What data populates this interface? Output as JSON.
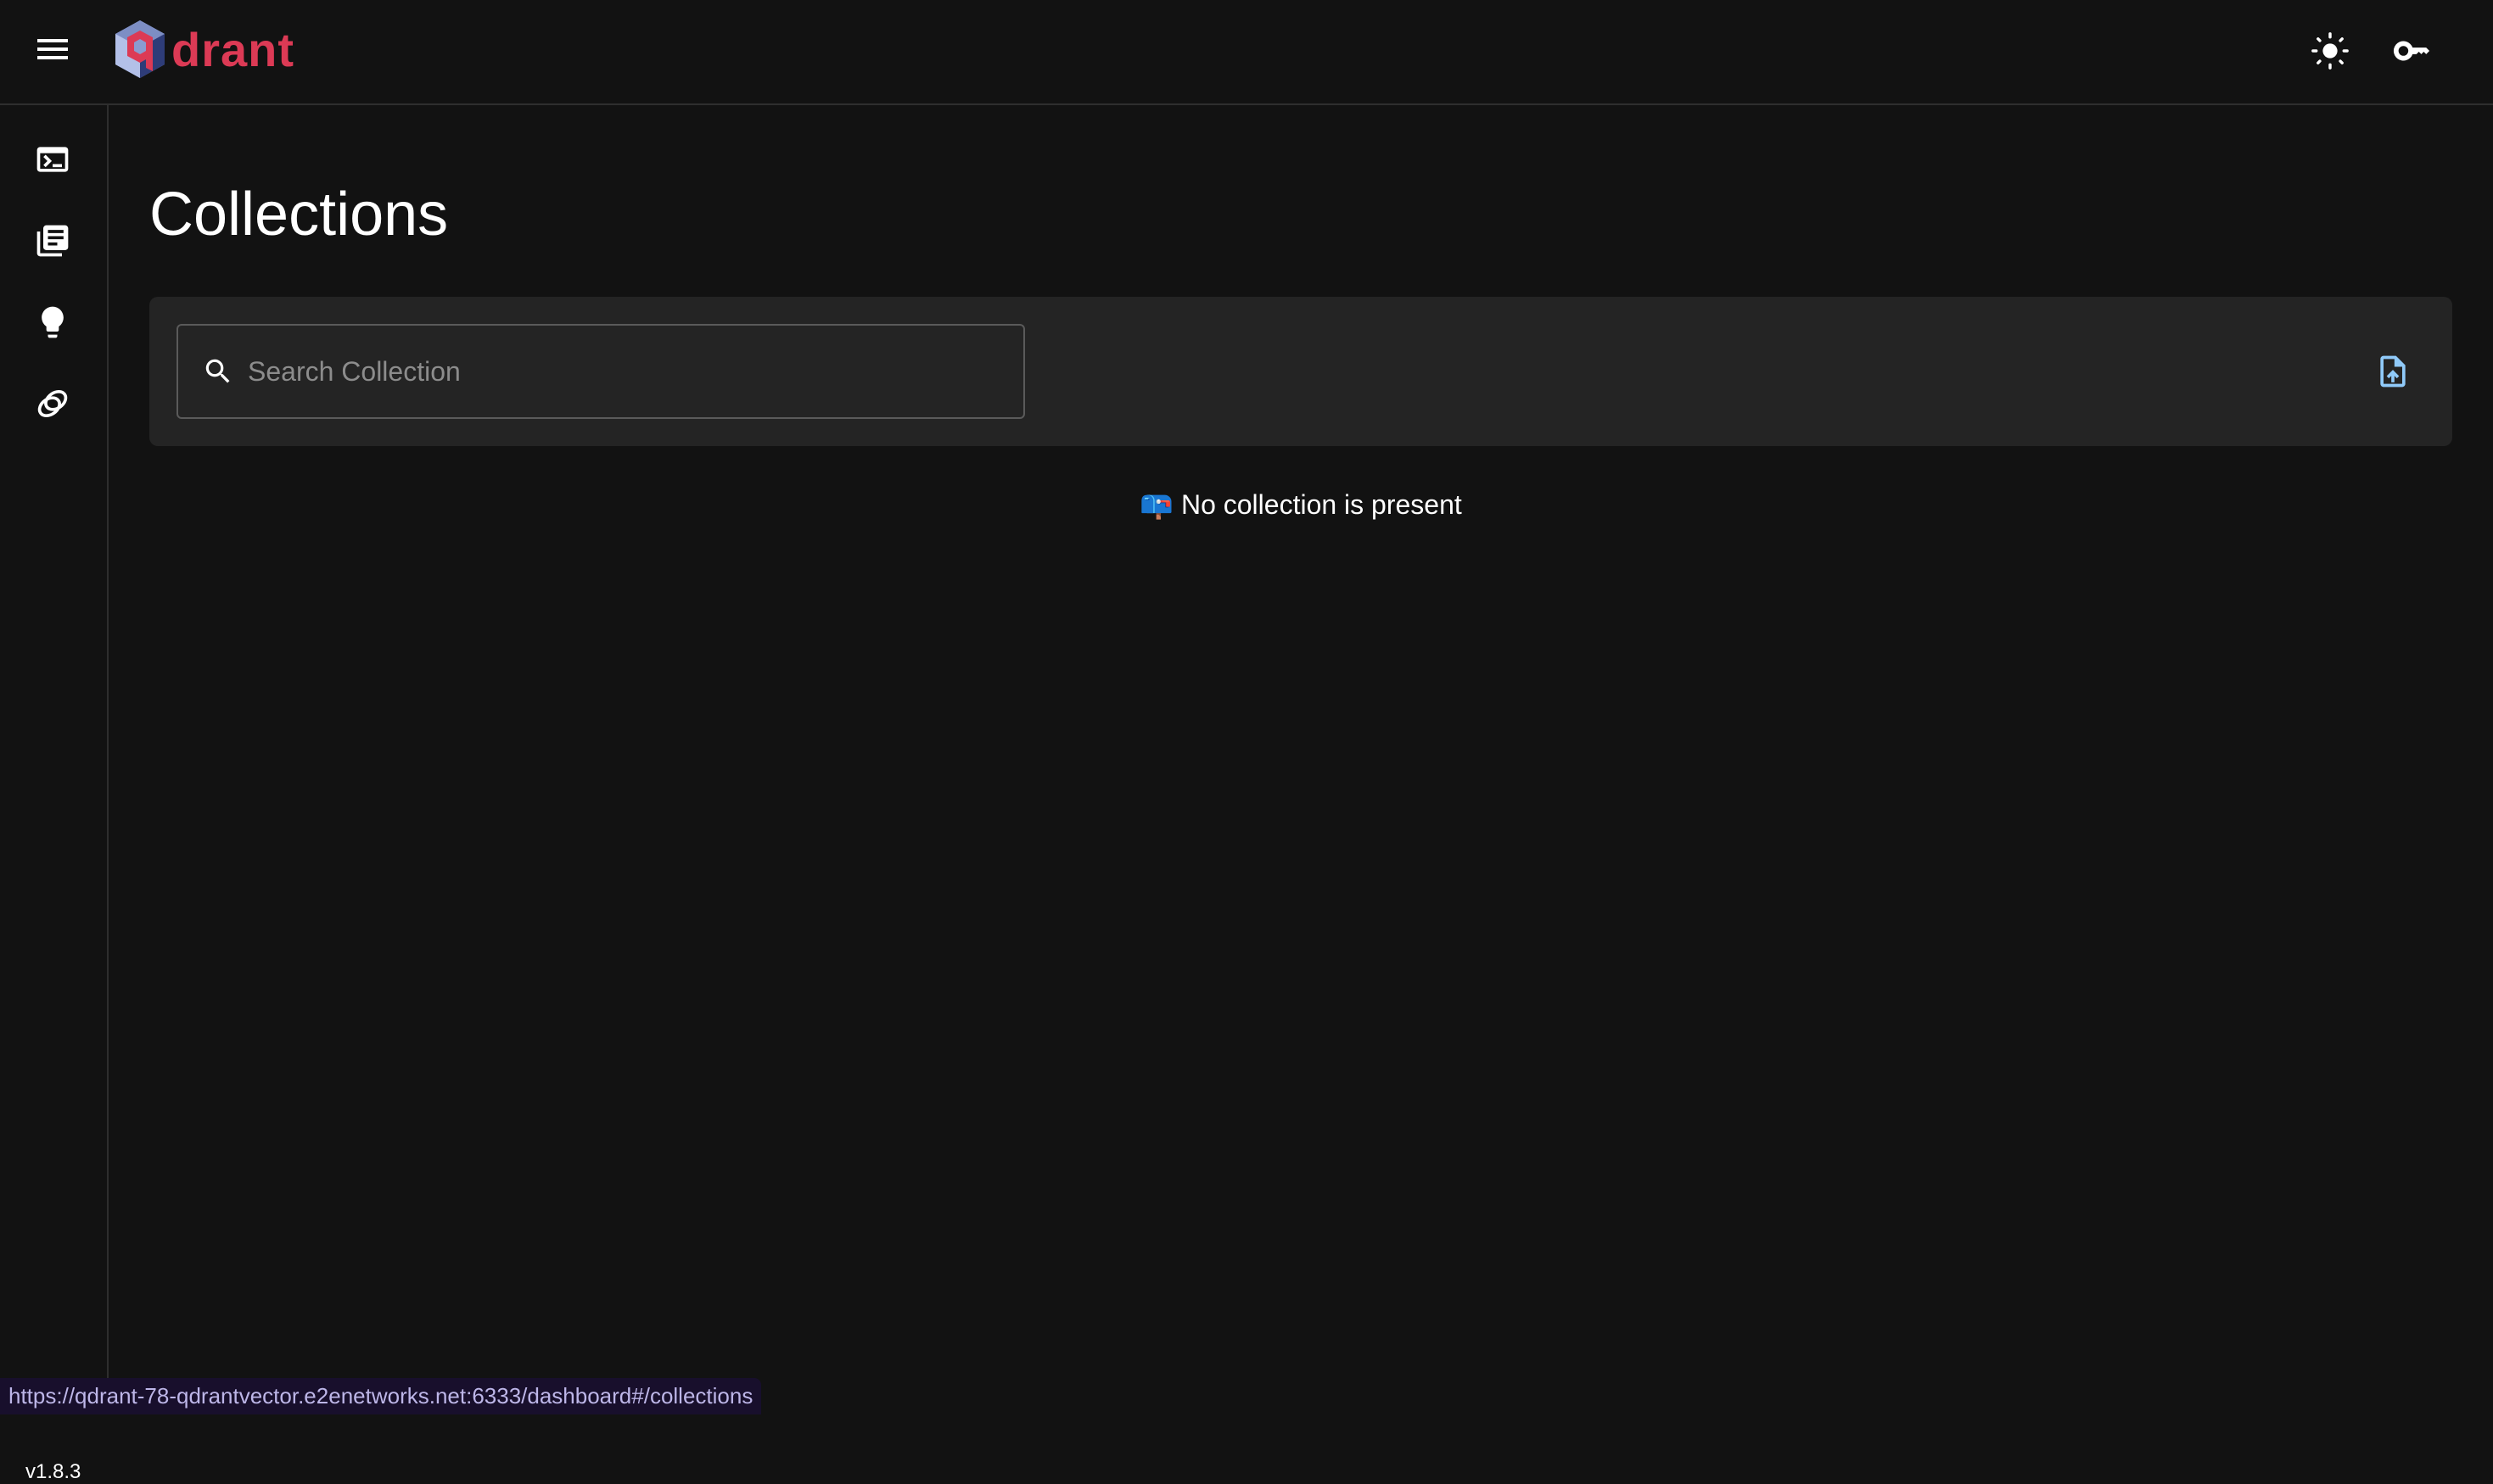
{
  "header": {
    "brand": "drant",
    "brand_color": "#dc3a55",
    "icons": [
      "menu-icon",
      "sun-icon",
      "key-icon"
    ]
  },
  "sidebar": {
    "items": [
      {
        "icon": "terminal-icon",
        "name": "console"
      },
      {
        "icon": "library-books-icon",
        "name": "collections"
      },
      {
        "icon": "lightbulb-icon",
        "name": "tutorial"
      },
      {
        "icon": "datasets-icon",
        "name": "datasets"
      }
    ],
    "version": "v1.8.3"
  },
  "main": {
    "title": "Collections",
    "search": {
      "placeholder": "Search Collection",
      "value": ""
    },
    "upload_icon": "file-upload-icon",
    "accent": "#90caf9",
    "empty_emoji": "📪",
    "empty_message": "No collection is present"
  },
  "status_url": "https://qdrant-78-qdrantvector.e2enetworks.net:6333/dashboard#/collections"
}
